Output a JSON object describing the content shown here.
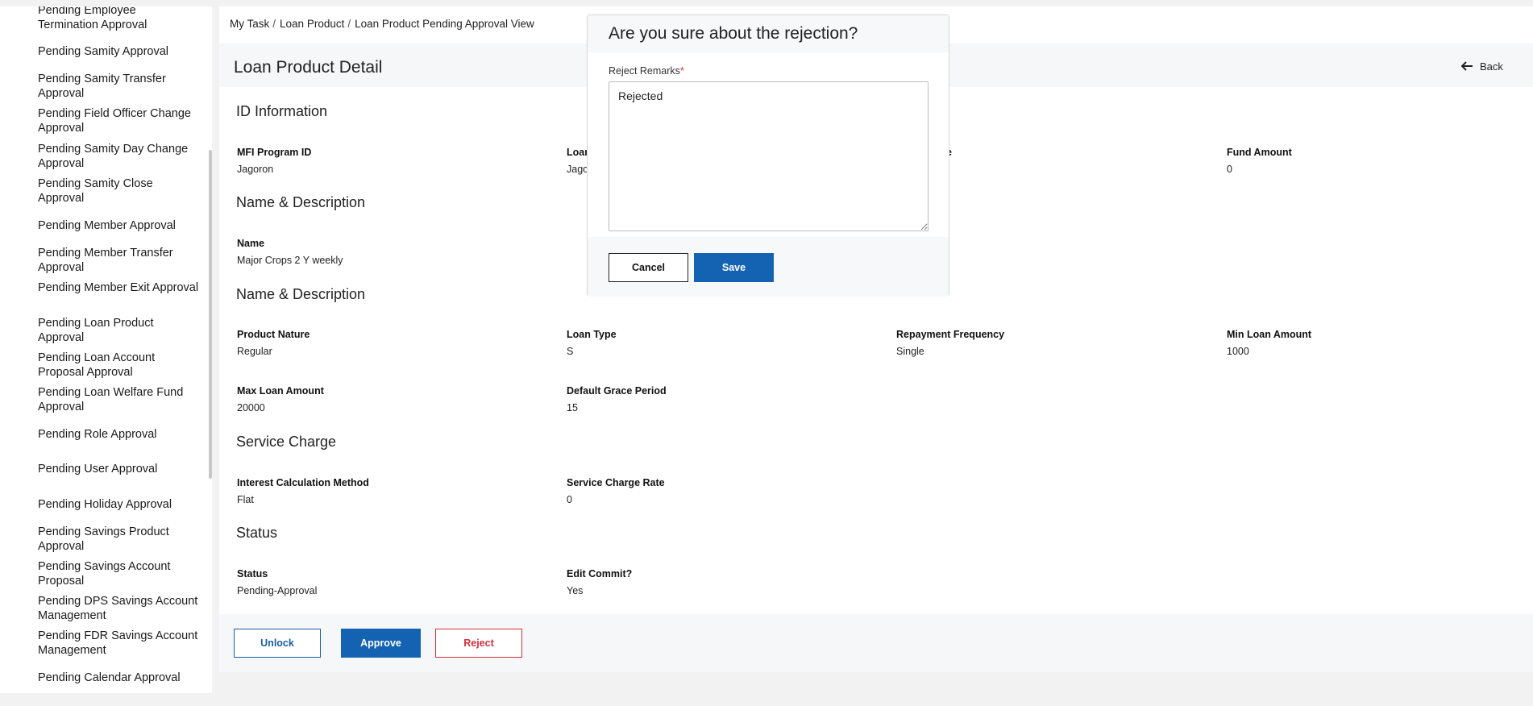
{
  "sidebar": {
    "items": [
      {
        "label": "Pending Employee Termination Approval"
      },
      {
        "label": "Pending Samity Approval"
      },
      {
        "label": "Pending Samity Transfer Approval"
      },
      {
        "label": "Pending Field Officer Change Approval"
      },
      {
        "label": "Pending Samity Day Change Approval"
      },
      {
        "label": "Pending Samity Close Approval"
      },
      {
        "label": "Pending Member Approval"
      },
      {
        "label": "Pending Member Transfer Approval"
      },
      {
        "label": "Pending Member Exit Approval"
      },
      {
        "label": "Pending Loan Product Approval"
      },
      {
        "label": "Pending Loan Account Proposal Approval"
      },
      {
        "label": "Pending Loan Welfare Fund Approval"
      },
      {
        "label": "Pending Role Approval"
      },
      {
        "label": "Pending User Approval"
      },
      {
        "label": "Pending Holiday Approval"
      },
      {
        "label": "Pending Savings Product Approval"
      },
      {
        "label": "Pending Savings Account Proposal"
      },
      {
        "label": "Pending DPS Savings Account Management"
      },
      {
        "label": "Pending FDR Savings Account Management"
      },
      {
        "label": "Pending Calendar Approval"
      }
    ]
  },
  "breadcrumb": {
    "items": [
      "My Task",
      "Loan Product",
      "Loan Product Pending Approval View"
    ],
    "separator": "/"
  },
  "page": {
    "title": "Loan Product Detail",
    "back_label": "Back"
  },
  "sections": {
    "id_info": {
      "title": "ID Information",
      "fields": [
        {
          "label": "MFI Program ID",
          "value": "Jagoron"
        },
        {
          "label": "Loan",
          "value": "Jago"
        },
        {
          "label": "e",
          "value": ""
        },
        {
          "label": "Fund Amount",
          "value": "0"
        }
      ]
    },
    "name_desc_1": {
      "title": "Name & Description",
      "fields": [
        {
          "label": "Name",
          "value": "Major Crops 2 Y weekly"
        }
      ]
    },
    "name_desc_2": {
      "title": "Name & Description",
      "fields": [
        {
          "label": "Product Nature",
          "value": "Regular"
        },
        {
          "label": "Loan Type",
          "value": "S"
        },
        {
          "label": "Repayment Frequency",
          "value": "Single"
        },
        {
          "label": "Min Loan Amount",
          "value": "1000"
        },
        {
          "label": "Max Loan Amount",
          "value": "20000"
        },
        {
          "label": "Default Grace Period",
          "value": "15"
        }
      ]
    },
    "service_charge": {
      "title": "Service Charge",
      "fields": [
        {
          "label": "Interest Calculation Method",
          "value": "Flat"
        },
        {
          "label": "Service Charge Rate",
          "value": "0"
        }
      ]
    },
    "status": {
      "title": "Status",
      "fields": [
        {
          "label": "Status",
          "value": "Pending-Approval"
        },
        {
          "label": "Edit Commit?",
          "value": "Yes"
        }
      ]
    }
  },
  "actions": {
    "unlock": "Unlock",
    "approve": "Approve",
    "reject": "Reject"
  },
  "modal": {
    "title": "Are you sure about the rejection?",
    "field_label": "Reject Remarks",
    "required_mark": "*",
    "remarks_value": "Rejected",
    "cancel": "Cancel",
    "save": "Save"
  },
  "colors": {
    "primary": "#1463b3",
    "danger": "#d0303a",
    "strip": "#f5f7f9",
    "background": "#f2f2f2"
  }
}
